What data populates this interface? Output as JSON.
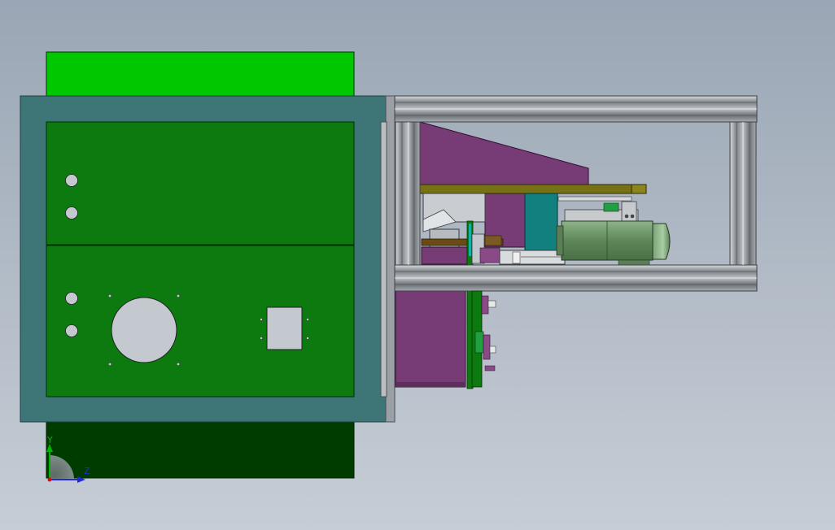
{
  "viewport": {
    "background_top": "#9aa6b5",
    "background_bottom": "#c6cdd6"
  },
  "model": {
    "colors": {
      "frame_teal": "#3e7677",
      "panel_green": "#0d7a10",
      "top_bright_green": "#00c700",
      "bottom_dark_green": "#003c00",
      "hole_gray": "#c4c9d0",
      "aluminum": "#8c9196",
      "purple": "#773b76",
      "olive": "#777116",
      "motor_green": "#6b9366",
      "teal_block": "#138080"
    }
  },
  "triad": {
    "y_axis_label": "Y",
    "z_axis_label": "Z",
    "y_color": "#00b400",
    "z_color": "#1e2ad4",
    "origin_color": "#d01010"
  }
}
